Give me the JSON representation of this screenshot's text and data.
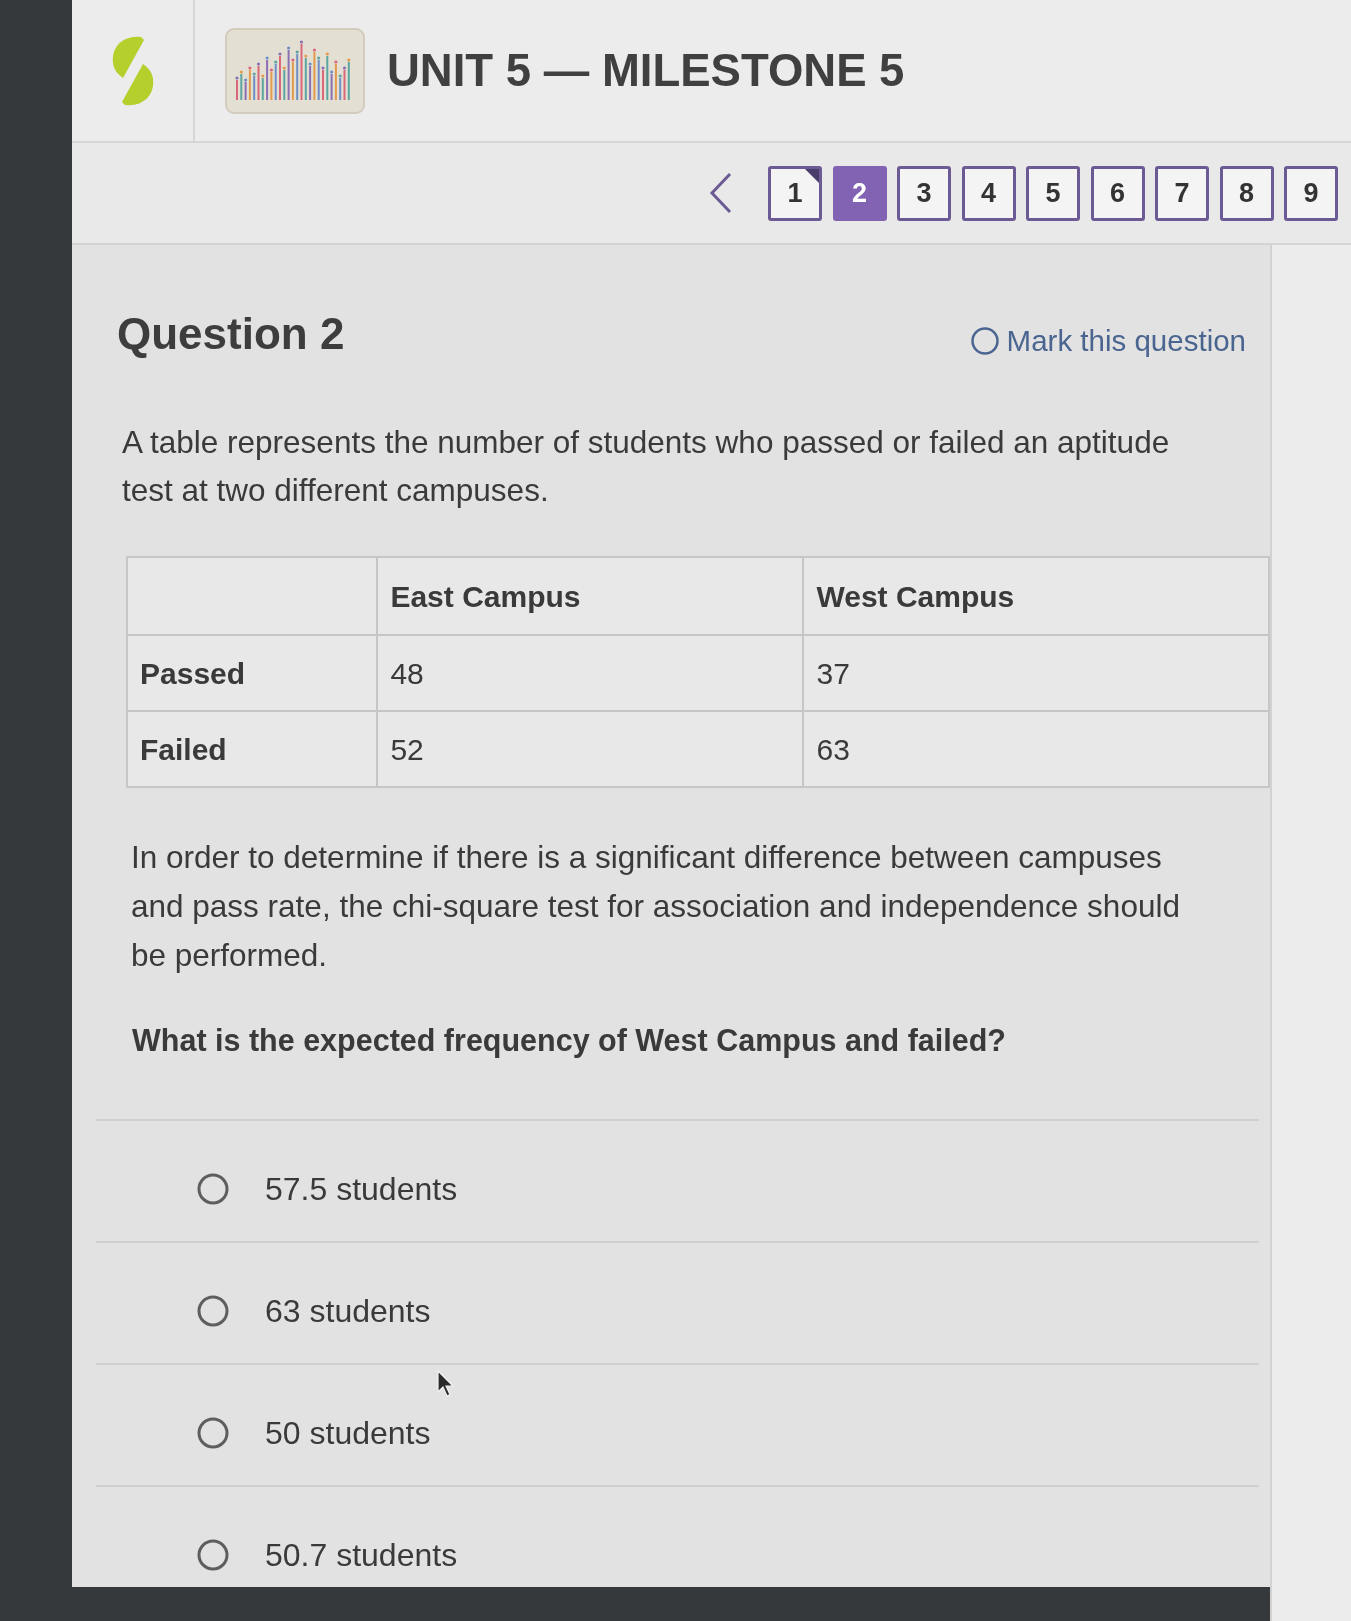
{
  "header": {
    "title": "UNIT 5 — MILESTONE 5"
  },
  "pager": {
    "pages": [
      {
        "label": "1",
        "selected": false,
        "answered": true
      },
      {
        "label": "2",
        "selected": true,
        "answered": false
      },
      {
        "label": "3",
        "selected": false,
        "answered": false
      },
      {
        "label": "4",
        "selected": false,
        "answered": false
      },
      {
        "label": "5",
        "selected": false,
        "answered": false
      },
      {
        "label": "6",
        "selected": false,
        "answered": false
      },
      {
        "label": "7",
        "selected": false,
        "answered": false
      },
      {
        "label": "8",
        "selected": false,
        "answered": false
      },
      {
        "label": "9",
        "selected": false,
        "answered": false
      }
    ]
  },
  "question": {
    "title": "Question 2",
    "mark_question": {
      "label": "Mark this question",
      "checked": false
    },
    "intro": "A table represents the number of students who passed or failed an aptitude test at two different campuses.",
    "table": {
      "columns": [
        "East Campus",
        "West Campus"
      ],
      "rows": [
        {
          "label": "Passed",
          "cells": [
            "48",
            "37"
          ]
        },
        {
          "label": "Failed",
          "cells": [
            "52",
            "63"
          ]
        }
      ]
    },
    "context": "In order to determine if there is a significant difference between campuses and pass rate, the chi-square test for association and independence should be performed.",
    "prompt": "What is the expected frequency of West Campus and failed?",
    "options": [
      {
        "label": "57.5 students",
        "selected": false
      },
      {
        "label": "63 students",
        "selected": false
      },
      {
        "label": "50 students",
        "selected": false
      },
      {
        "label": "50.7 students",
        "selected": false
      }
    ]
  }
}
